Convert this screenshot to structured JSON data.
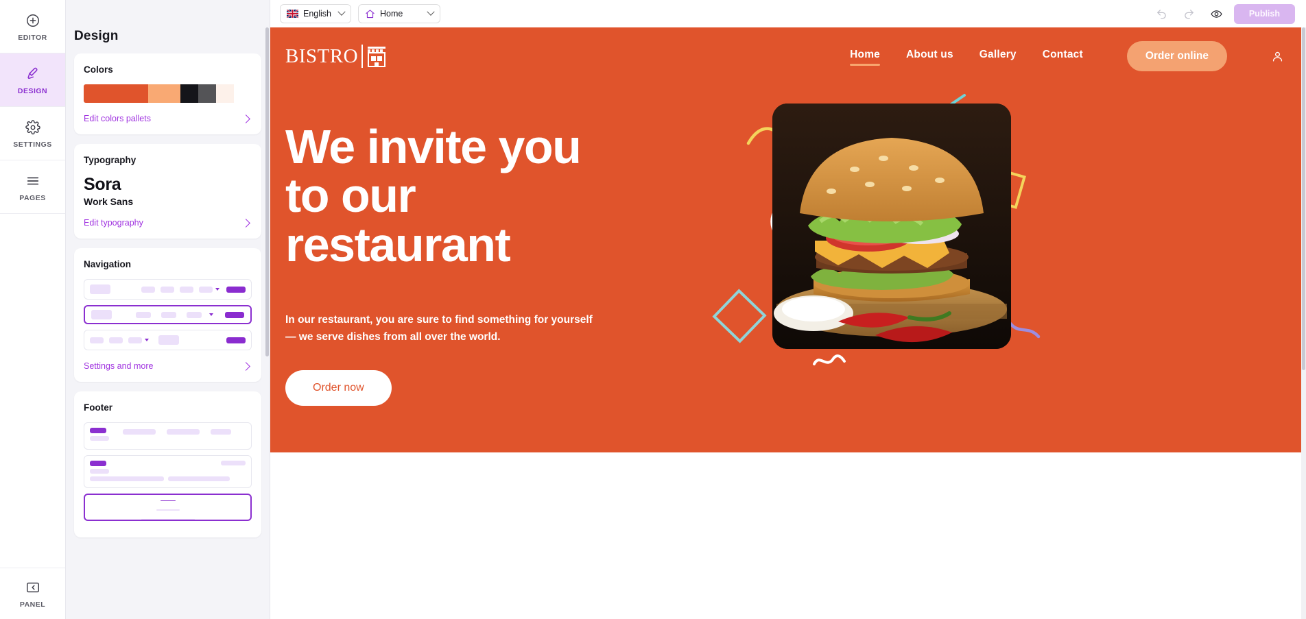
{
  "rail": {
    "items": [
      {
        "label": "EDITOR",
        "icon": "plus-circle-icon",
        "active": false
      },
      {
        "label": "DESIGN",
        "icon": "brush-icon",
        "active": true
      },
      {
        "label": "SETTINGS",
        "icon": "gear-icon",
        "active": false
      },
      {
        "label": "PAGES",
        "icon": "menu-lines-icon",
        "active": false
      }
    ],
    "bottom": {
      "label": "PANEL",
      "icon": "collapse-panel-icon"
    }
  },
  "panel": {
    "title": "Design",
    "colors": {
      "heading": "Colors",
      "swatches": [
        {
          "hex": "#e0542c",
          "flex": 4
        },
        {
          "hex": "#f9a973",
          "flex": 2
        },
        {
          "hex": "#15151a",
          "flex": 1
        },
        {
          "hex": "#545457",
          "flex": 1
        },
        {
          "hex": "#fdf1ea",
          "flex": 1
        },
        {
          "hex": "#ffffff",
          "flex": 1
        }
      ],
      "edit_link": "Edit colors pallets"
    },
    "typography": {
      "heading": "Typography",
      "heading_font": "Sora",
      "body_font": "Work Sans",
      "edit_link": "Edit typography"
    },
    "navigation": {
      "heading": "Navigation",
      "options": [
        {
          "id": "nav-layout-1",
          "selected": false
        },
        {
          "id": "nav-layout-2",
          "selected": true
        },
        {
          "id": "nav-layout-3",
          "selected": false
        }
      ],
      "settings_link": "Settings and more"
    },
    "footer": {
      "heading": "Footer",
      "options": [
        {
          "id": "footer-layout-1",
          "selected": false
        },
        {
          "id": "footer-layout-2",
          "selected": false
        },
        {
          "id": "footer-layout-3",
          "selected": true
        }
      ]
    }
  },
  "toolbar": {
    "language": {
      "value": "English",
      "icon": "uk-flag-icon"
    },
    "page": {
      "value": "Home",
      "icon": "home-icon"
    },
    "undo_icon": "undo-icon",
    "redo_icon": "redo-icon",
    "preview_icon": "eye-icon",
    "publish_label": "Publish"
  },
  "site": {
    "logo": {
      "text": "BISTRO",
      "icon": "storefront-icon"
    },
    "nav": [
      {
        "label": "Home",
        "active": true
      },
      {
        "label": "About us",
        "active": false
      },
      {
        "label": "Gallery",
        "active": false
      },
      {
        "label": "Contact",
        "active": false
      }
    ],
    "cta_label": "Order online",
    "account_icon": "user-icon",
    "hero": {
      "heading_line1": "We invite you",
      "heading_line2": "to our",
      "heading_line3": "restaurant",
      "paragraph": "In our restaurant, you are sure to find something for yourself — we serve dishes from all over the world.",
      "button_label": "Order now",
      "image_alt": "burger-photo"
    },
    "colors": {
      "background": "#e0542c",
      "accent": "#f4a271",
      "text": "#ffffff"
    }
  }
}
